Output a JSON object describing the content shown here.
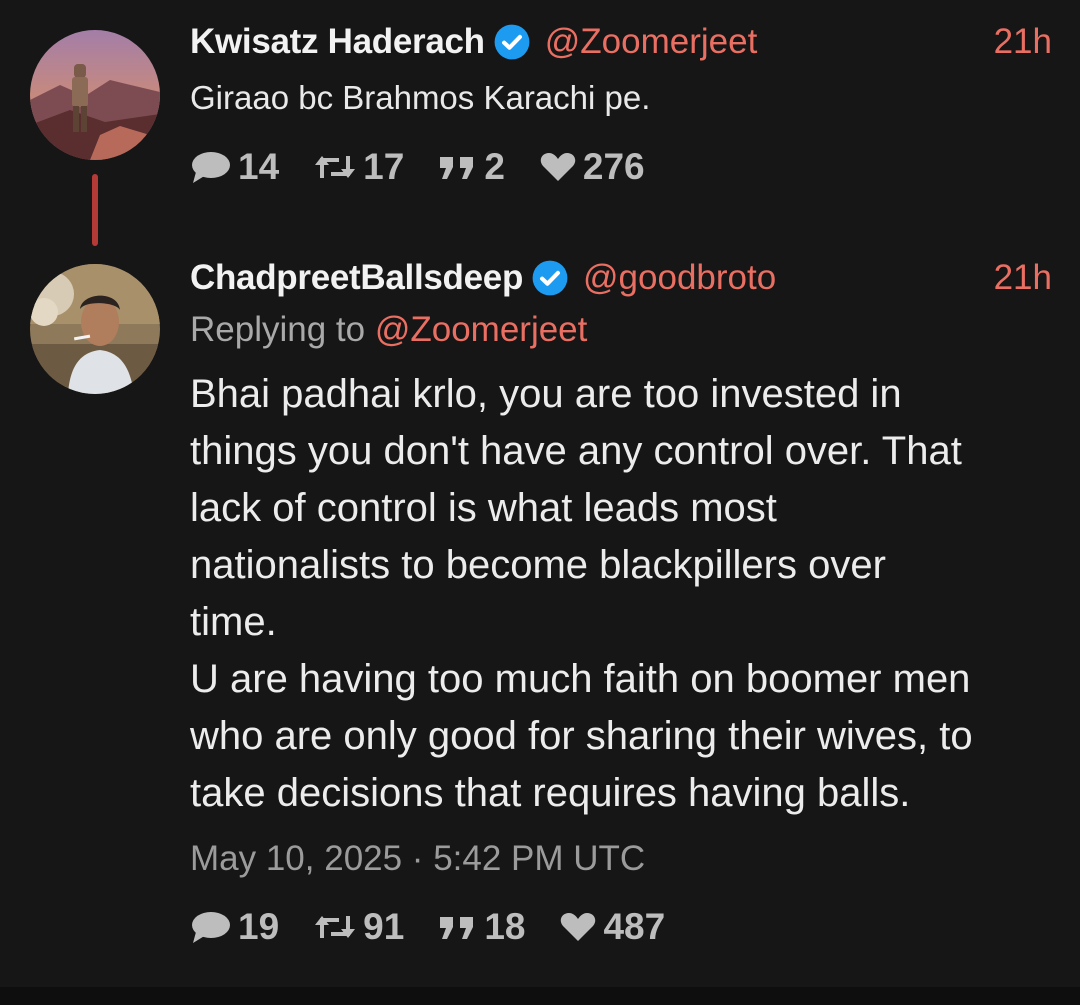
{
  "thread": {
    "tweets": [
      {
        "display_name": "Kwisatz Haderach",
        "username": "@Zoomerjeet",
        "time": "21h",
        "text": "Giraao bc Brahmos Karachi pe.",
        "stats": {
          "replies": "14",
          "retweets": "17",
          "quotes": "2",
          "likes": "276"
        },
        "verified": true
      },
      {
        "display_name": "ChadpreetBallsdeep",
        "username": "@goodbroto",
        "time": "21h",
        "replying_prefix": "Replying to ",
        "replying_to": "@Zoomerjeet",
        "text": "Bhai padhai krlo, you are too invested in\nthings you don't have any control over. That\nlack of control is what leads most\nnationalists to become blackpillers over\ntime.\nU are having too much faith on boomer men\nwho are only good for sharing their wives, to\ntake decisions that requires having balls.",
        "datetime": "May 10, 2025 · 5:42 PM UTC",
        "stats": {
          "replies": "19",
          "retweets": "91",
          "quotes": "18",
          "likes": "487"
        },
        "verified": true
      }
    ]
  },
  "colors": {
    "background": "#161616",
    "accent": "#ea6f63",
    "thread_line": "#b33a37",
    "verified_badge": "#1d9bf0",
    "muted_text": "#9b9b9b"
  },
  "icons": [
    "verified-icon",
    "reply-icon",
    "retweet-icon",
    "quote-icon",
    "like-icon"
  ]
}
